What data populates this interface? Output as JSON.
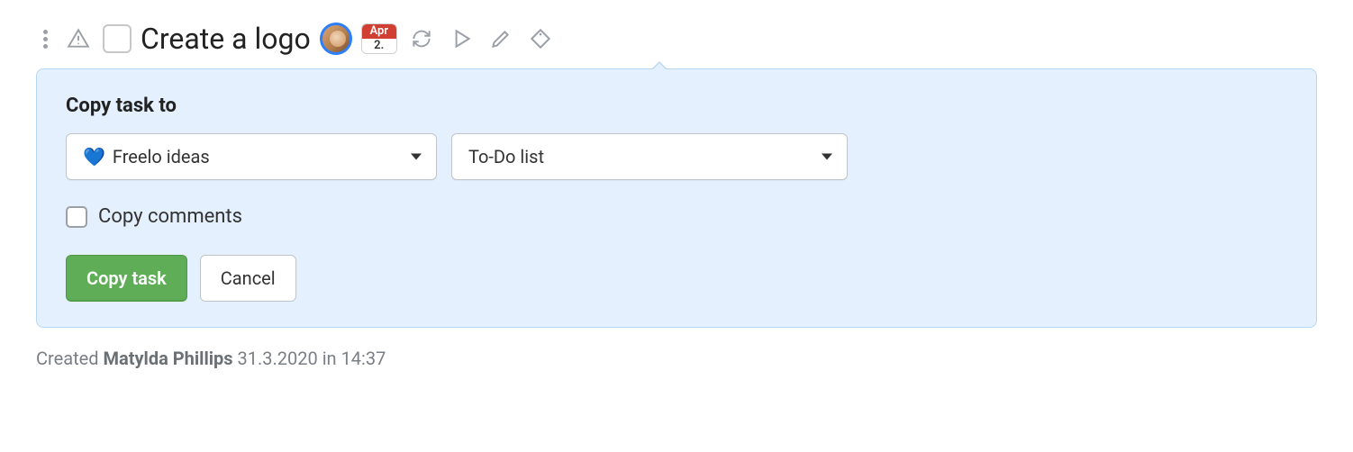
{
  "task": {
    "title": "Create a logo",
    "date": {
      "month": "Apr",
      "day": "2."
    }
  },
  "panel": {
    "title": "Copy task to",
    "select_project": "Freelo ideas",
    "select_list": "To-Do list",
    "copy_comments_label": "Copy comments",
    "submit_label": "Copy task",
    "cancel_label": "Cancel"
  },
  "meta": {
    "created_prefix": "Created ",
    "author": "Matylda Phillips",
    "timestamp": " 31.3.2020 in 14:37"
  }
}
